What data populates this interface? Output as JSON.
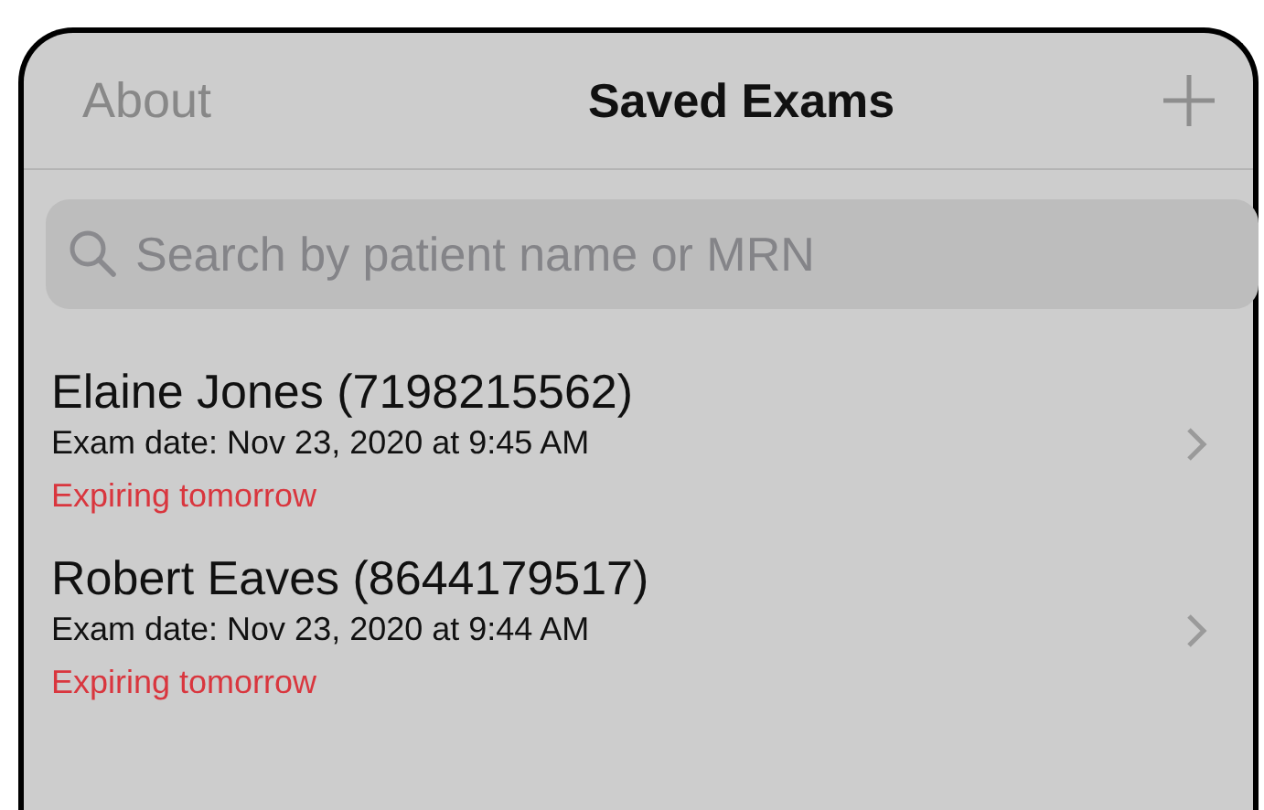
{
  "nav_bar": {
    "left_button": "About",
    "title": "Saved Exams"
  },
  "search": {
    "placeholder": "Search by patient name or MRN"
  },
  "exams": [
    {
      "patient": "Elaine Jones (7198215562)",
      "exam_date": "Exam date: Nov 23, 2020 at 9:45 AM",
      "status": "Expiring tomorrow"
    },
    {
      "patient": "Robert Eaves (8644179517)",
      "exam_date": "Exam date: Nov 23, 2020 at 9:44 AM",
      "status": "Expiring tomorrow"
    }
  ]
}
